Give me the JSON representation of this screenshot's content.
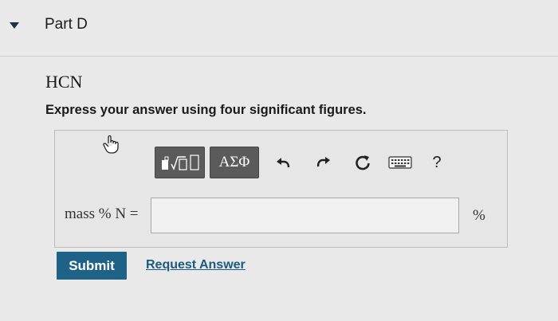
{
  "part": {
    "title": "Part D"
  },
  "question": {
    "formula": "HCN",
    "instruction": "Express your answer using four significant figures."
  },
  "toolbar": {
    "symbols_label": "ΑΣΦ",
    "help_label": "?",
    "icons": [
      "templates-icon",
      "undo-icon",
      "redo-icon",
      "reset-icon",
      "keyboard-icon",
      "help-icon"
    ]
  },
  "answer": {
    "label": "mass % N =",
    "value": "",
    "unit": "%"
  },
  "actions": {
    "submit_label": "Submit",
    "request_label": "Request Answer"
  },
  "colors": {
    "submit": "#1f6287",
    "link": "#1d5a80",
    "toolbar_button": "#5b5b5b"
  }
}
